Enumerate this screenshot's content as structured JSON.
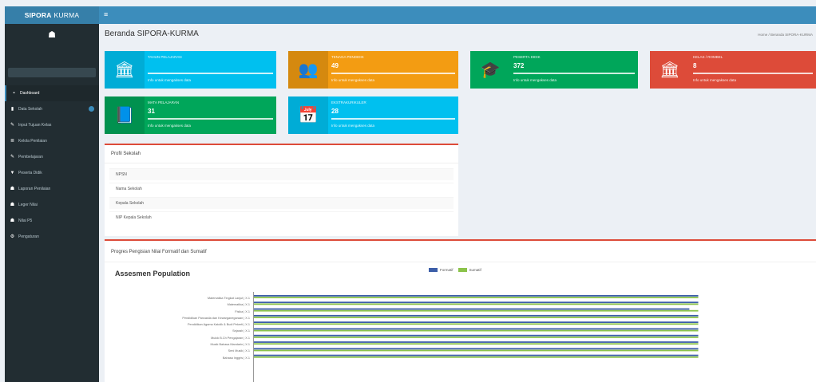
{
  "app": {
    "logo_bold": "SIPORA",
    "logo_thin": "KURMA"
  },
  "sidebar": {
    "items": [
      {
        "label": "Dashboard",
        "icon": "dashboard-icon"
      },
      {
        "label": "Data Sekolah",
        "icon": "building-icon"
      },
      {
        "label": "Input Tujuan Kelas",
        "icon": "edit-icon"
      },
      {
        "label": "Kelola Penilaian",
        "icon": "list-icon"
      },
      {
        "label": "Pembelajaran",
        "icon": "book-icon"
      },
      {
        "label": "Peserta Didik",
        "icon": "user-icon"
      },
      {
        "label": "Laporan Penilaian",
        "icon": "report-icon"
      },
      {
        "label": "Leger Nilai",
        "icon": "table-icon"
      },
      {
        "label": "Nilai P5",
        "icon": "star-icon"
      },
      {
        "label": "Pengaturan",
        "icon": "gear-icon"
      }
    ]
  },
  "header": {
    "title": "Beranda SIPORA-KURMA",
    "subtitle": "",
    "breadcrumb": "Home / Beranda SIPORA-KURMA"
  },
  "info_boxes": [
    {
      "label": "Tahun Pelajaran",
      "value": "",
      "more": "Info untuk mengakses data",
      "color": "#00c0ef",
      "icon": "institution-icon"
    },
    {
      "label": "Tenaga Pendidik",
      "value": "49",
      "more": "Info untuk mengakses data",
      "color": "#f39c12",
      "icon": "users-icon"
    },
    {
      "label": "Peserta Didik",
      "value": "372",
      "more": "Info untuk mengakses data",
      "color": "#00a65a",
      "icon": "graduation-cap-icon"
    },
    {
      "label": "Kelas / Rombel",
      "value": "8",
      "more": "Info untuk mengakses data",
      "color": "#dd4b39",
      "icon": "institution-icon"
    },
    {
      "label": "Mata Pelajaran",
      "value": "31",
      "more": "Info untuk mengakses data",
      "color": "#00a65a",
      "icon": "book-icon"
    },
    {
      "label": "Ekstrakurikuler",
      "value": "28",
      "more": "Info untuk mengakses data",
      "color": "#00c0ef",
      "icon": "calendar-icon"
    }
  ],
  "profile": {
    "title": "Profil Sekolah",
    "rows": [
      {
        "label": "NPSN",
        "value": ""
      },
      {
        "label": "Nama Sekolah",
        "value": ""
      },
      {
        "label": "Kepala Sekolah",
        "value": ""
      },
      {
        "label": "NIP Kepala Sekolah",
        "value": ""
      }
    ]
  },
  "progress": {
    "title": "Progres Pengisian Nilai Formatif dan Sumatif",
    "heading": "Assesmen Population"
  },
  "chart_data": {
    "type": "bar",
    "orientation": "horizontal",
    "title": "Assesmen Population",
    "categories": [
      "Matematika Tingkat Lanjut | X.1",
      "Matematika | X.1",
      "Fisika | X.1",
      "Pendidikan Pancasila dan Kewarganegaraan | X.1",
      "Pendidikan Agama Katolik & Budi Pekerti | X.1",
      "Sejarah | X.1",
      "Mulok B.Ch Pengajaran | X.1",
      "Musik Bahasa Mandarin | X.1",
      "Seni Musik | X.1",
      "Bahasa Inggris | X.1"
    ],
    "series": [
      {
        "name": "Formatif",
        "color": "#3c5ea8",
        "values": [
          100,
          100,
          98,
          100,
          100,
          100,
          100,
          100,
          100,
          100
        ]
      },
      {
        "name": "Sumatif",
        "color": "#8bc34a",
        "values": [
          100,
          100,
          100,
          100,
          100,
          100,
          100,
          100,
          100,
          100
        ]
      }
    ],
    "xlim": [
      0,
      115
    ],
    "legend": "top"
  }
}
